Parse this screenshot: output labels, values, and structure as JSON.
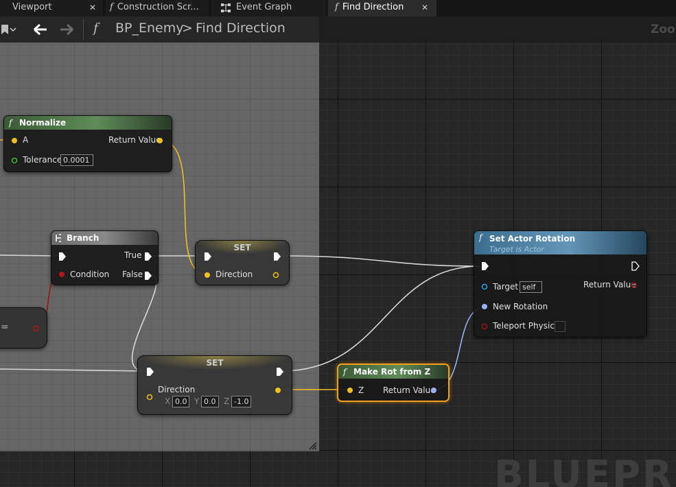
{
  "tabs": [
    {
      "label": "Viewport",
      "close": "✕"
    },
    {
      "label": "Construction Scr...",
      "glyph": "f"
    },
    {
      "label": "Event Graph",
      "icon": "graph-icon"
    },
    {
      "label": "Find Direction",
      "glyph": "f",
      "close": "✕"
    }
  ],
  "breadcrumb": {
    "function_glyph": "f",
    "blueprint": "BP_Enemy",
    "separator": ">",
    "function": "Find Direction"
  },
  "zoom_label": "Zoom",
  "watermark": "BLUEPRINT",
  "nodes": {
    "normalize": {
      "glyph": "f",
      "title": "Normalize",
      "pin_a": "A",
      "return_value": "Return Value",
      "tolerance_label": "Tolerance",
      "tolerance_value": "0.0001"
    },
    "branch": {
      "title": "Branch",
      "true_label": "True",
      "false_label": "False",
      "condition_label": "Condition"
    },
    "set_top": {
      "title": "SET",
      "pin_label": "Direction"
    },
    "set_bottom": {
      "title": "SET",
      "pin_label": "Direction",
      "x_label": "X",
      "x_value": "0.0",
      "y_label": "Y",
      "y_value": "0.0",
      "z_label": "Z",
      "z_value": "-1.0"
    },
    "make_rot": {
      "glyph": "f",
      "title": "Make Rot from Z",
      "pin_z": "Z",
      "return_value": "Return Value"
    },
    "set_actor_rotation": {
      "glyph": "f",
      "title": "Set Actor Rotation",
      "subtitle": "Target is Actor",
      "target_label": "Target",
      "target_value": "self",
      "return_value": "Return Value",
      "new_rotation_label": "New Rotation",
      "teleport_label": "Teleport Physics"
    },
    "equals_fragment": {
      "label": "="
    }
  },
  "colors": {
    "exec": "#ffffff",
    "vector": "#f0c020",
    "float": "#35c235",
    "bool": "#9a1414",
    "rotator": "#9ab0f0",
    "object": "#2aa0e0",
    "selection": "#f0a020"
  }
}
